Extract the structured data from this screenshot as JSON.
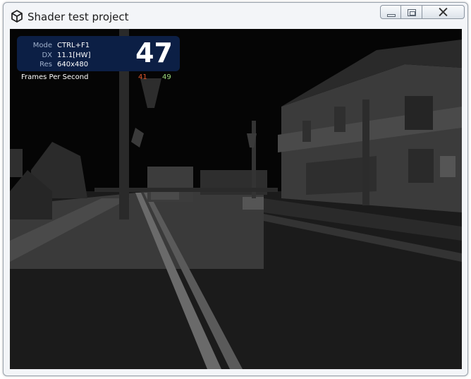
{
  "window": {
    "title": "Shader test project",
    "app_icon": "unity-logo-icon"
  },
  "hud": {
    "mode_label": "Mode",
    "mode_value": "CTRL+F1",
    "dx_label": "DX",
    "dx_value": "11.1[HW]",
    "res_label": "Res",
    "res_value": "640x480",
    "fps_value": "47",
    "fps_caption": "Frames Per Second",
    "fps_min": "41",
    "fps_max": "49"
  },
  "colors": {
    "hud_background": "#0c1f45",
    "fps_min_color": "#e0562a",
    "fps_max_color": "#9edc7e"
  }
}
